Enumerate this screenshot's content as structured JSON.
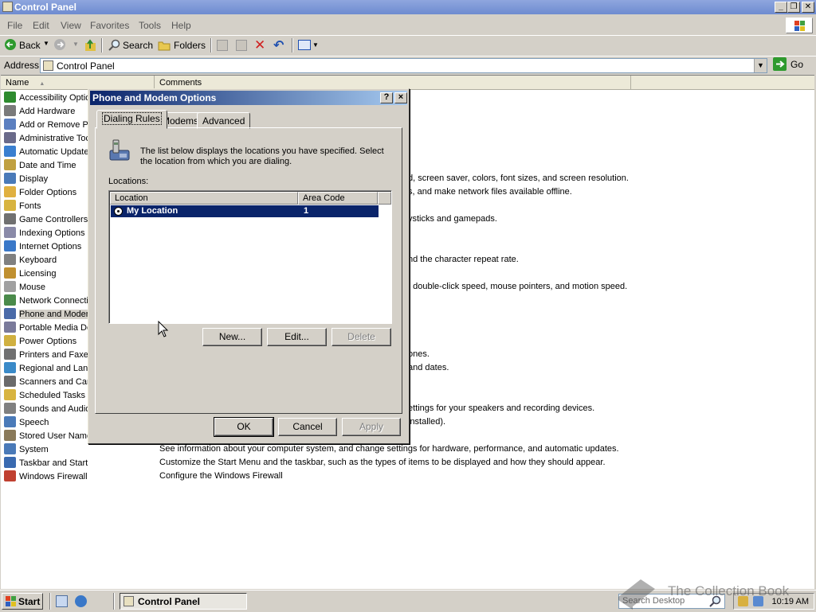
{
  "window": {
    "title": "Control Panel"
  },
  "menu": [
    "File",
    "Edit",
    "View",
    "Favorites",
    "Tools",
    "Help"
  ],
  "toolbar": {
    "back": "Back",
    "search": "Search",
    "folders": "Folders"
  },
  "address": {
    "label": "Address",
    "value": "Control Panel",
    "go": "Go"
  },
  "columns": {
    "name": "Name",
    "comments": "Comments"
  },
  "items": [
    {
      "label": "Accessibility Optio",
      "color": "#2e8b2e"
    },
    {
      "label": "Add Hardware",
      "color": "#7a7a7a"
    },
    {
      "label": "Add or Remove Pr",
      "color": "#5b7fc0"
    },
    {
      "label": "Administrative Toc",
      "color": "#6a6a8a"
    },
    {
      "label": "Automatic Update",
      "color": "#3a7fd0"
    },
    {
      "label": "Date and Time",
      "color": "#c0a040"
    },
    {
      "label": "Display",
      "color": "#4a7ab8"
    },
    {
      "label": "Folder Options",
      "color": "#e0b040"
    },
    {
      "label": "Fonts",
      "color": "#d8b440"
    },
    {
      "label": "Game Controllers",
      "color": "#707070"
    },
    {
      "label": "Indexing Options",
      "color": "#8a8aa8"
    },
    {
      "label": "Internet Options",
      "color": "#3a78c8"
    },
    {
      "label": "Keyboard",
      "color": "#808080"
    },
    {
      "label": "Licensing",
      "color": "#c09030"
    },
    {
      "label": "Mouse",
      "color": "#a0a0a0"
    },
    {
      "label": "Network Connecti",
      "color": "#4a8a4a"
    },
    {
      "label": "Phone and Modem",
      "color": "#4a6aa8"
    },
    {
      "label": "Portable Media De",
      "color": "#7a7a9a"
    },
    {
      "label": "Power Options",
      "color": "#d0b040"
    },
    {
      "label": "Printers and Faxe",
      "color": "#707070"
    },
    {
      "label": "Regional and Lang",
      "color": "#3a8ac8"
    },
    {
      "label": "Scanners and Cam",
      "color": "#6a6a6a"
    },
    {
      "label": "Scheduled Tasks",
      "color": "#d8b440"
    },
    {
      "label": "Sounds and Audio",
      "color": "#808080"
    },
    {
      "label": "Speech",
      "color": "#4a7ab8"
    },
    {
      "label": "Stored User Name",
      "color": "#8a7a5a"
    },
    {
      "label": "System",
      "color": "#4a7ab8"
    },
    {
      "label": "Taskbar and Start Menu",
      "color": "#3a6ab0"
    },
    {
      "label": "Windows Firewall",
      "color": "#c04030"
    }
  ],
  "comments": [
    {
      "row": 6,
      "text": "d, screen saver, colors, font sizes, and screen resolution."
    },
    {
      "row": 7,
      "text": "s, and make network files available offline."
    },
    {
      "row": 9,
      "text": "ysticks and gamepads."
    },
    {
      "row": 12,
      "text": "nd the character repeat rate."
    },
    {
      "row": 14,
      "text": ", double-click speed, mouse pointers, and motion speed."
    },
    {
      "row": 19,
      "text": "ones."
    },
    {
      "row": 20,
      "text": "and dates."
    },
    {
      "row": 23,
      "text": "ettings for your speakers and recording devices."
    },
    {
      "row": 24,
      "text": " installed)."
    },
    {
      "row": 26,
      "text": "See information about your computer system, and change settings for hardware, performance, and automatic updates."
    },
    {
      "row": 27,
      "text": "Customize the Start Menu and the taskbar, such as the types of items to be displayed and how they should appear."
    },
    {
      "row": 28,
      "text": "Configure the Windows Firewall"
    }
  ],
  "dialog": {
    "title": "Phone and Modem Options",
    "help": "?",
    "close": "×",
    "tabs": [
      "Dialing Rules",
      "Modems",
      "Advanced"
    ],
    "description": "The list below displays the locations you have specified. Select the location from which you are dialing.",
    "locations_label": "Locations:",
    "list_headers": [
      "Location",
      "Area Code"
    ],
    "rows": [
      {
        "location": "My Location",
        "area_code": "1"
      }
    ],
    "buttons": {
      "new": "New...",
      "edit": "Edit...",
      "delete": "Delete",
      "ok": "OK",
      "cancel": "Cancel",
      "apply": "Apply"
    }
  },
  "taskbar": {
    "start": "Start",
    "task": "Control Panel",
    "search": "Search Desktop",
    "time": "10:19 AM"
  },
  "watermark": "The Collection Book"
}
